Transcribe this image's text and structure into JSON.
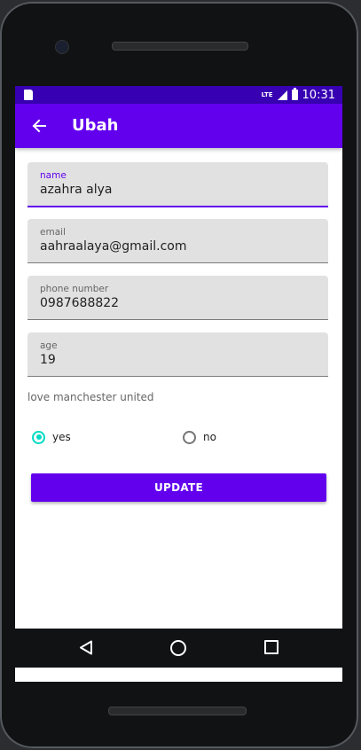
{
  "status_bar": {
    "network": "LTE",
    "time": "10:31"
  },
  "app_bar": {
    "title": "Ubah",
    "back_icon": "arrow-back-icon"
  },
  "form": {
    "fields": [
      {
        "label": "name",
        "value": "azahra alya",
        "focused": true
      },
      {
        "label": "email",
        "value": "aahraalaya@gmail.com",
        "focused": false
      },
      {
        "label": "phone number",
        "value": "0987688822",
        "focused": false
      },
      {
        "label": "age",
        "value": "19",
        "focused": false
      }
    ],
    "note": "love manchester united",
    "radio_options": [
      {
        "label": "yes",
        "checked": true
      },
      {
        "label": "no",
        "checked": false
      }
    ],
    "submit_label": "UPDATE"
  },
  "colors": {
    "primary": "#6200ee",
    "primary_dark": "#3700b3",
    "accent": "#03dac5"
  },
  "nav_bar": {
    "back_icon": "nav-back-icon",
    "home_icon": "nav-home-icon",
    "recents_icon": "nav-recents-icon"
  }
}
